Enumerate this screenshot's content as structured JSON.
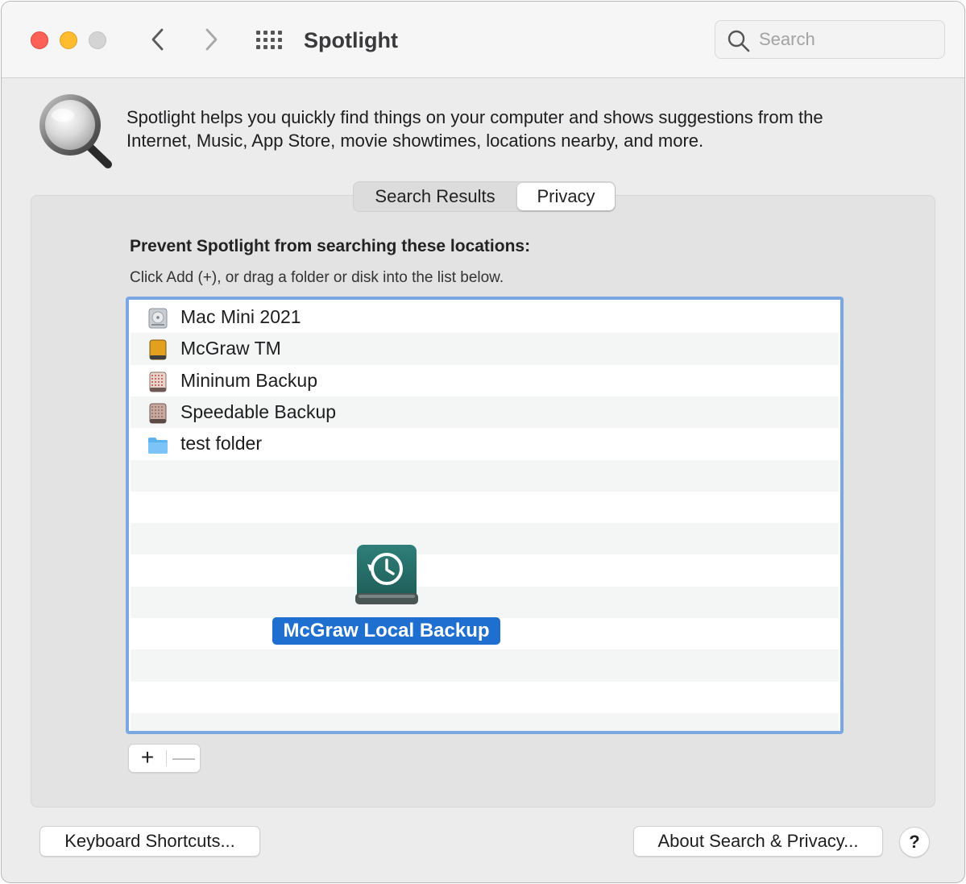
{
  "window": {
    "title": "Spotlight",
    "search_placeholder": "Search"
  },
  "header": {
    "description_line1": "Spotlight helps you quickly find things on your computer and shows suggestions from the",
    "description_line2": "Internet, Music, App Store, movie showtimes, locations nearby, and more."
  },
  "tabs": [
    {
      "label": "Search Results",
      "selected": false
    },
    {
      "label": "Privacy",
      "selected": true
    }
  ],
  "privacy": {
    "heading": "Prevent Spotlight from searching these locations:",
    "hint": "Click Add (+), or drag a folder or disk into the list below.",
    "items": [
      {
        "label": "Mac Mini 2021",
        "icon": "internal-disk-icon"
      },
      {
        "label": "McGraw TM",
        "icon": "external-disk-icon"
      },
      {
        "label": "Mininum Backup",
        "icon": "backup-disk-icon"
      },
      {
        "label": "Speedable Backup",
        "icon": "backup-disk-icon"
      },
      {
        "label": "test folder",
        "icon": "folder-icon"
      }
    ],
    "dragging_item": {
      "label": "McGraw Local Backup",
      "icon": "time-machine-disk-icon"
    },
    "add_label": "+",
    "remove_label": "—"
  },
  "footer": {
    "keyboard_shortcuts_label": "Keyboard Shortcuts...",
    "about_label": "About Search & Privacy...",
    "help_label": "?"
  },
  "colors": {
    "accent": "#1f6fd0",
    "list_focus_ring": "#7ba7e2",
    "close": "#fe5f57",
    "minimize": "#febc2e",
    "zoom_disabled": "#d4d4d4"
  }
}
